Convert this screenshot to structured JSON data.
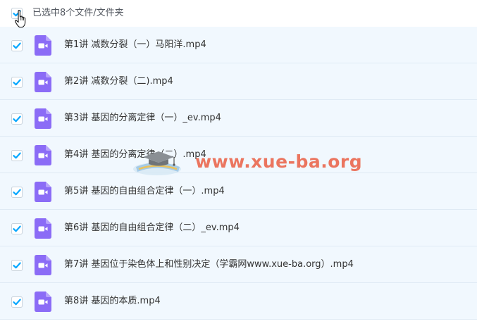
{
  "header": {
    "selection_text": "已选中8个文件/文件夹",
    "select_all_checked": true
  },
  "files": [
    {
      "name": "第1讲 减数分裂（一）马阳洋.mp4",
      "checked": true,
      "icon": "video-file-icon"
    },
    {
      "name": "第2讲 减数分裂（二).mp4",
      "checked": true,
      "icon": "video-file-icon"
    },
    {
      "name": "第3讲 基因的分离定律（一）_ev.mp4",
      "checked": true,
      "icon": "video-file-icon"
    },
    {
      "name": "第4讲 基因的分离定律（二）.mp4",
      "checked": true,
      "icon": "video-file-icon"
    },
    {
      "name": "第5讲 基因的自由组合定律（一）.mp4",
      "checked": true,
      "icon": "video-file-icon"
    },
    {
      "name": "第6讲 基因的自由组合定律（二）_ev.mp4",
      "checked": true,
      "icon": "video-file-icon"
    },
    {
      "name": "第7讲 基因位于染色体上和性别决定（学霸网www.xue-ba.org）.mp4",
      "checked": true,
      "icon": "video-file-icon"
    },
    {
      "name": "第8讲 基因的本质.mp4",
      "checked": true,
      "icon": "video-file-icon"
    }
  ],
  "watermark": {
    "text": "www.xue-ba.org"
  },
  "colors": {
    "accent": "#06a7ff",
    "row_bg": "#f1f8fe",
    "video_icon": "#8b6cf6",
    "watermark": "#e95032"
  }
}
